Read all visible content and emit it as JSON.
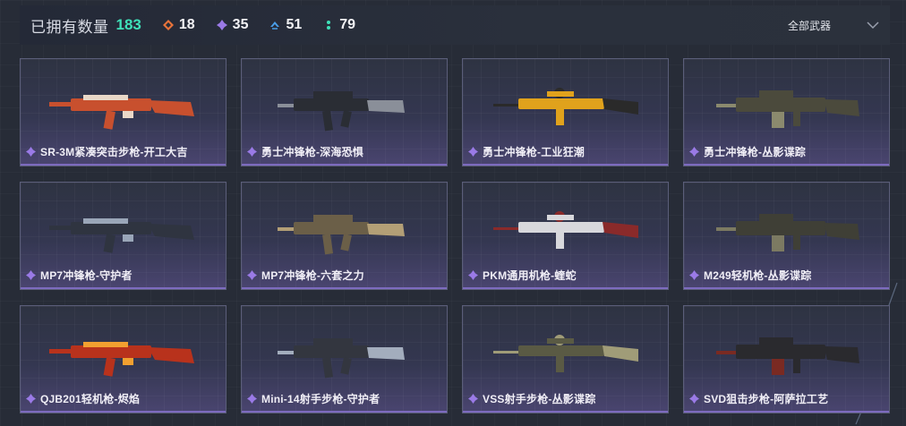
{
  "header": {
    "owned_label": "已拥有数量",
    "owned_count": "183",
    "rarities": [
      {
        "icon": "orange-diamond-icon",
        "color": "#e8733a",
        "count": "18"
      },
      {
        "icon": "purple-diamond-icon",
        "color": "#9a7ae6",
        "count": "35"
      },
      {
        "icon": "blue-chevron-icon",
        "color": "#4a9ee8",
        "count": "51"
      },
      {
        "icon": "green-dots-icon",
        "color": "#3fe0b8",
        "count": "79"
      }
    ],
    "filter_label": "全部武器"
  },
  "weapons": [
    {
      "name": "SR-3M紧凑突击步枪-开工大吉",
      "skin_color": "#c8502e",
      "accent": "#e9d8c8"
    },
    {
      "name": "勇士冲锋枪-深海恐惧",
      "skin_color": "#2a2d34",
      "accent": "#8a8f99"
    },
    {
      "name": "勇士冲锋枪-工业狂潮",
      "skin_color": "#e0a21c",
      "accent": "#2a2a2a"
    },
    {
      "name": "勇士冲锋枪-丛影谍踪",
      "skin_color": "#4b4a3c",
      "accent": "#8b8a6e"
    },
    {
      "name": "MP7冲锋枪-守护者",
      "skin_color": "#2f3440",
      "accent": "#9aa6b8"
    },
    {
      "name": "MP7冲锋枪-六套之力",
      "skin_color": "#6b5f48",
      "accent": "#b39f76"
    },
    {
      "name": "PKM通用机枪-蝰蛇",
      "skin_color": "#d8d8dc",
      "accent": "#8a2a2a"
    },
    {
      "name": "M249轻机枪-丛影谍踪",
      "skin_color": "#3f3f36",
      "accent": "#7c7a62"
    },
    {
      "name": "QJB201轻机枪-烬焰",
      "skin_color": "#b8321c",
      "accent": "#f2a030"
    },
    {
      "name": "Mini-14射手步枪-守护者",
      "skin_color": "#33363f",
      "accent": "#a3adbd"
    },
    {
      "name": "VSS射手步枪-丛影谍踪",
      "skin_color": "#5a5a44",
      "accent": "#a09c78"
    },
    {
      "name": "SVD狙击步枪-阿萨拉工艺",
      "skin_color": "#2a2a2e",
      "accent": "#7a2a22"
    }
  ]
}
